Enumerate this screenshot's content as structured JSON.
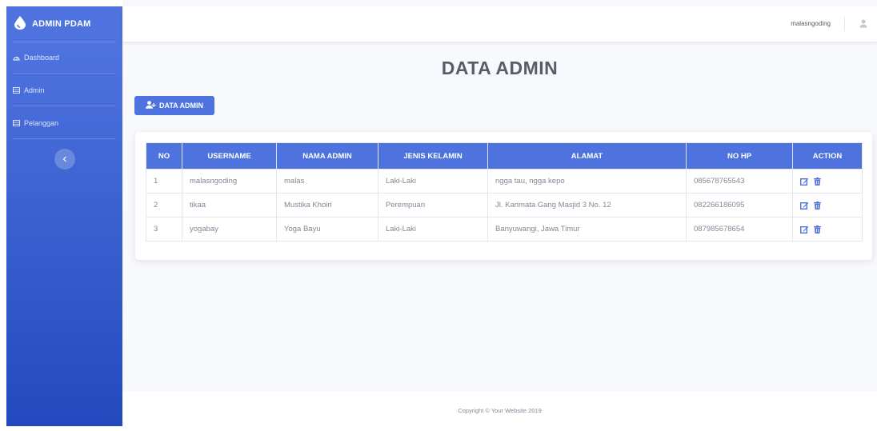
{
  "sidebar": {
    "brand": "ADMIN PDAM",
    "items": [
      {
        "label": "Dashboard"
      },
      {
        "label": "Admin"
      },
      {
        "label": "Pelanggan"
      }
    ]
  },
  "topbar": {
    "username": "malasngoding"
  },
  "page": {
    "title": "DATA ADMIN",
    "add_button": "DATA ADMIN"
  },
  "table": {
    "headers": [
      "NO",
      "USERNAME",
      "NAMA ADMIN",
      "JENIS KELAMIN",
      "ALAMAT",
      "NO HP",
      "ACTION"
    ],
    "rows": [
      [
        "1",
        "malasngoding",
        "malas",
        "Laki-Laki",
        "ngga tau, ngga kepo",
        "085678765543"
      ],
      [
        "2",
        "tikaa",
        "Mustika Khoiri",
        "Perempuan",
        "Jl. Karimata Gang Masjid 3 No. 12",
        "082266186095"
      ],
      [
        "3",
        "yogabay",
        "Yoga Bayu",
        "Laki-Laki",
        "Banyuwangi, Jawa Timur",
        "087985678654"
      ]
    ]
  },
  "footer": {
    "text": "Copyright © Your Website 2019"
  },
  "colors": {
    "primary": "#4e73df",
    "gradient_end": "#224abe",
    "text_muted": "#858796"
  }
}
